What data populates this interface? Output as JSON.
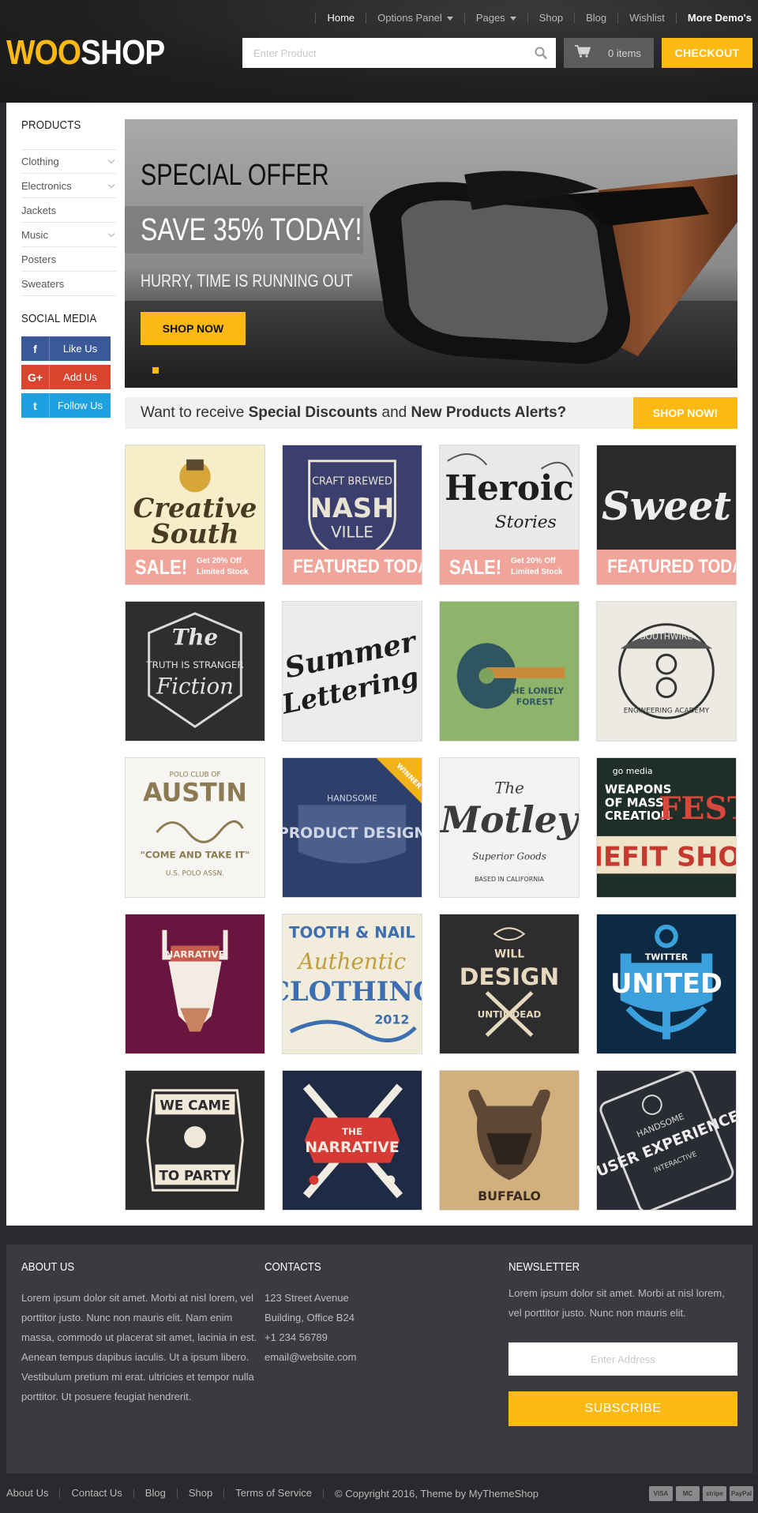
{
  "header": {
    "logo_woo": "WOO",
    "logo_shop": "SHOP",
    "nav": [
      {
        "label": "Home"
      },
      {
        "label": "Options Panel"
      },
      {
        "label": "Pages"
      },
      {
        "label": "Shop"
      },
      {
        "label": "Blog"
      },
      {
        "label": "Wishlist"
      },
      {
        "label": "More Demo's"
      }
    ],
    "search_placeholder": "Enter Product",
    "cart_label": "0 items",
    "checkout_label": "CHECKOUT"
  },
  "sidebar": {
    "products_heading": "PRODUCTS",
    "categories": [
      "Clothing",
      "Electronics",
      "Jackets",
      "Music",
      "Posters",
      "Sweaters"
    ],
    "social_heading": "SOCIAL MEDIA",
    "social": [
      {
        "icon": "f",
        "label": "Like Us"
      },
      {
        "icon": "G+",
        "label": "Add Us"
      },
      {
        "icon": "t",
        "label": "Follow Us"
      }
    ]
  },
  "banner": {
    "title": "SPECIAL OFFER",
    "save": "SAVE 35% TODAY!",
    "hurry": "HURRY, TIME IS RUNNING OUT",
    "button": "SHOP NOW"
  },
  "alert": {
    "part1": "Want to receive ",
    "bold1": "Special Discounts",
    "part2": " and ",
    "bold2": "New Products Alerts?",
    "button": "SHOP NOW!"
  },
  "products": [
    {
      "art": "Creative South",
      "ribbon": "sale",
      "ribbon_big": "SALE!",
      "ribbon_small1": "Get 20% Off",
      "ribbon_small2": "Limited Stock"
    },
    {
      "art": "NASH VILLE",
      "ribbon": "featured",
      "ribbon_big": "FEATURED TODAY"
    },
    {
      "art": "Heroic Stories",
      "ribbon": "sale",
      "ribbon_big": "SALE!",
      "ribbon_small1": "Get 20% Off",
      "ribbon_small2": "Limited Stock"
    },
    {
      "art": "Sweet",
      "ribbon": "featured",
      "ribbon_big": "FEATURED TODAY"
    },
    {
      "art": "The Truth Is Stranger Than Fiction"
    },
    {
      "art": "Summer Lettering"
    },
    {
      "art": "The Lonely Forest"
    },
    {
      "art": "Southwire Engineering Academy"
    },
    {
      "art": "AUSTIN"
    },
    {
      "art": "PRODUCT DESIGN"
    },
    {
      "art": "The Motley"
    },
    {
      "art": "FEST"
    },
    {
      "art": "The Narrative"
    },
    {
      "art": "Tooth & Nail"
    },
    {
      "art": "DESIGN"
    },
    {
      "art": "UNITED"
    },
    {
      "art": "WE CAME TO PARTY"
    },
    {
      "art": "THE NARRATIVE"
    },
    {
      "art": "BUFFALO"
    },
    {
      "art": "USER EXPERIENCE"
    }
  ],
  "footer": {
    "about_heading": "ABOUT US",
    "about_text": "Lorem ipsum dolor sit amet. Morbi at nisl lorem, vel porttitor justo. Nunc non mauris elit. Nam enim massa, commodo ut placerat sit amet, lacinia in est. Aenean tempus dapibus iaculis. Ut a ipsum libero. Vestibulum pretium mi erat. ultricies et tempor nulla porttitor. Ut posuere feugiat hendrerit.",
    "contacts_heading": "CONTACTS",
    "contacts": [
      "123 Street Avenue",
      "Building, Office B24",
      "+1 234 56789",
      "email@website.com"
    ],
    "newsletter_heading": "NEWSLETTER",
    "newsletter_text": "Lorem ipsum dolor sit amet. Morbi at nisl lorem, vel porttitor justo. Nunc non mauris elit.",
    "newsletter_placeholder": "Enter Address",
    "subscribe_label": "SUBSCRIBE"
  },
  "bottom": {
    "links": [
      "About Us",
      "Contact Us",
      "Blog",
      "Shop",
      "Terms of Service"
    ],
    "copyright": "© Copyright 2016, Theme by MyThemeShop",
    "payments": [
      "VISA",
      "MC",
      "stripe",
      "PayPal"
    ]
  },
  "colors": {
    "accent": "#fdb913",
    "header_bg": "#201f20",
    "footer_bg": "#3b3a41",
    "sale_ribbon": "#f0a49a"
  }
}
